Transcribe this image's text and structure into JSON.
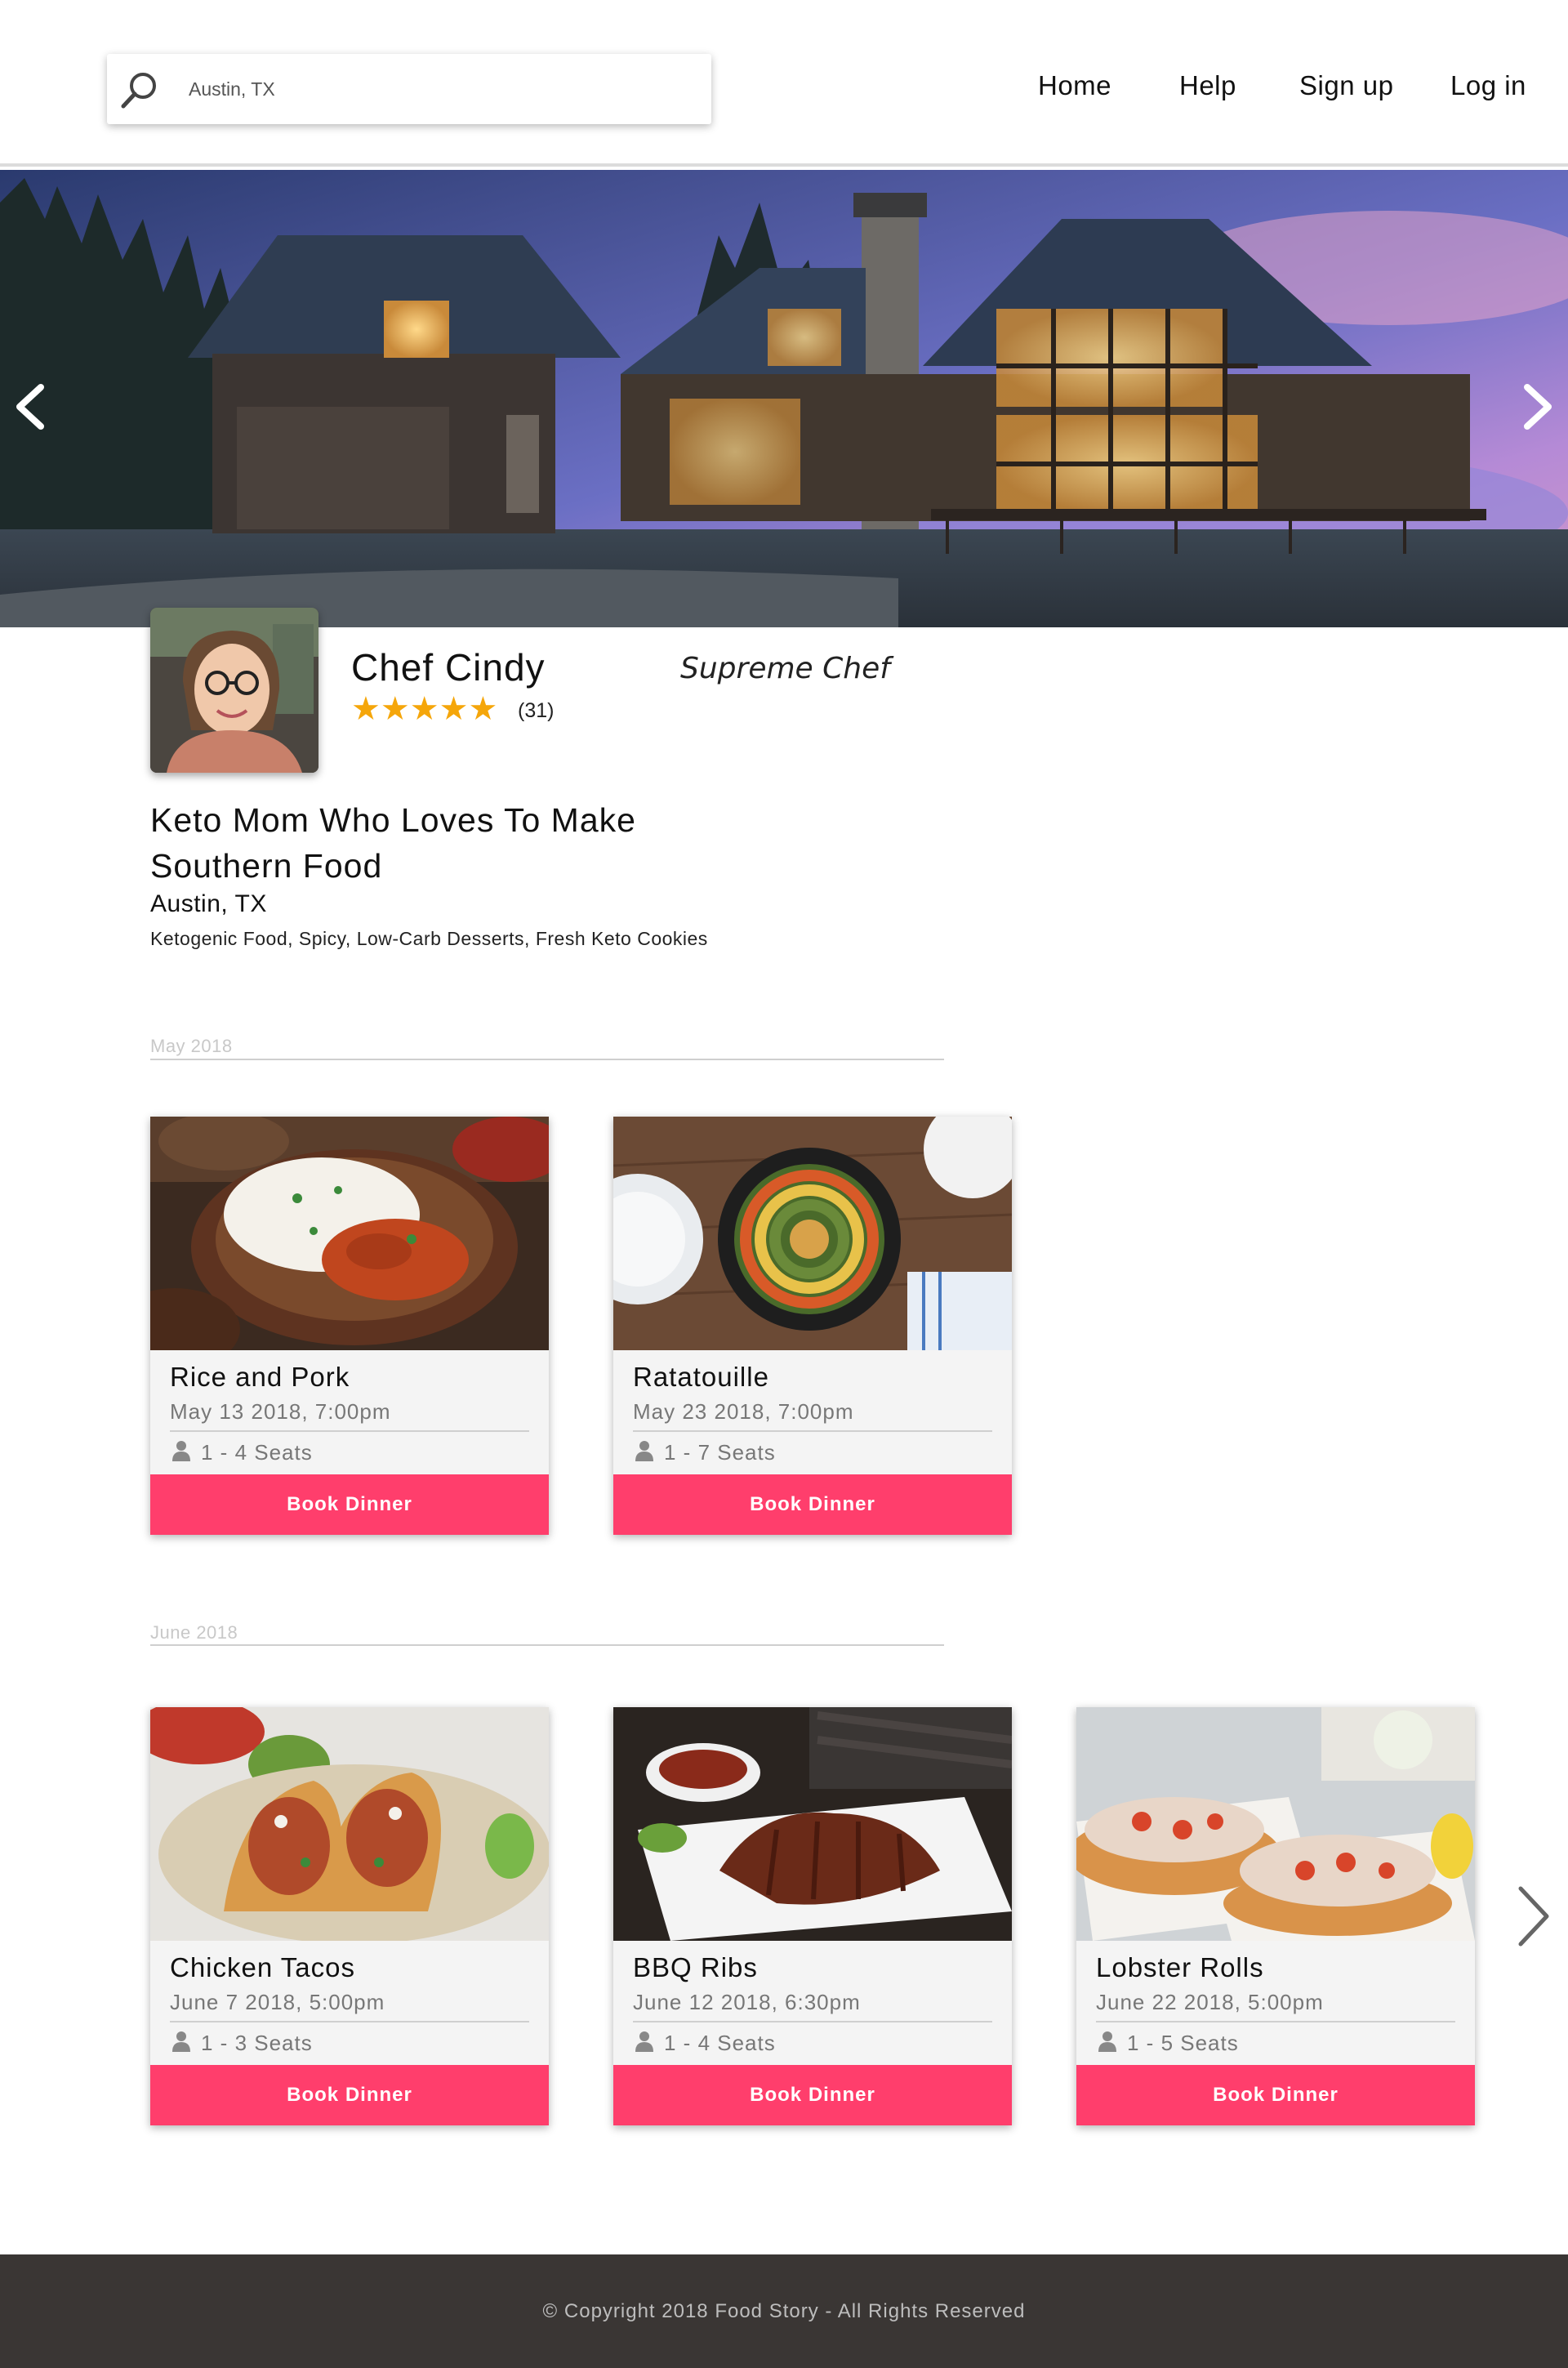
{
  "header": {
    "search": {
      "value": "Austin, TX",
      "placeholder": ""
    },
    "nav": {
      "home": "Home",
      "help": "Help",
      "sign_up": "Sign up",
      "log_in": "Log in"
    }
  },
  "hero": {
    "prev_icon": "chevron-left-icon",
    "next_icon": "chevron-right-icon"
  },
  "chef": {
    "name": "Chef Cindy",
    "stars": "★★★★★",
    "rating": 5,
    "rating_count": "(31)",
    "title": "Supreme Chef",
    "tagline": "Keto Mom Who Loves To Make Southern Food",
    "location": "Austin, TX",
    "specialties": "Ketogenic Food, Spicy, Low-Carb Desserts, Fresh Keto Cookies"
  },
  "months": [
    {
      "label": "May 2018",
      "dinners": [
        {
          "title": "Rice and Pork",
          "date": "May 13 2018, 7:00pm",
          "seats": "1 - 4 Seats",
          "button": "Book Dinner"
        },
        {
          "title": "Ratatouille",
          "date": "May 23 2018, 7:00pm",
          "seats": "1 - 7 Seats",
          "button": "Book Dinner"
        }
      ]
    },
    {
      "label": "June 2018",
      "dinners": [
        {
          "title": "Chicken Tacos",
          "date": "June 7 2018, 5:00pm",
          "seats": "1 - 3 Seats",
          "button": "Book Dinner"
        },
        {
          "title": "BBQ Ribs",
          "date": "June 12 2018, 6:30pm",
          "seats": "1 - 4 Seats",
          "button": "Book Dinner"
        },
        {
          "title": "Lobster Rolls",
          "date": "June 22 2018, 5:00pm",
          "seats": "1 - 5 Seats",
          "button": "Book Dinner"
        }
      ]
    }
  ],
  "footer": {
    "copyright": "© Copyright 2018 Food Story - All Rights Reserved"
  },
  "colors": {
    "accent": "#ff3e6c",
    "star": "#f5a60a",
    "footer_bg": "#3a3634"
  }
}
